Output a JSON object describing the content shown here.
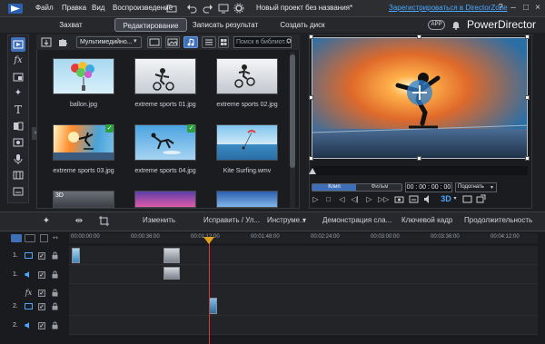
{
  "menu": {
    "file": "Файл",
    "edit": "Правка",
    "view": "Вид",
    "play": "Воспроизведение",
    "doc_title": "Новый проект без названия*",
    "register": "Зарегистрироваться в DirectorZone"
  },
  "modes": {
    "capture": "Захват",
    "edit": "Редактирование",
    "produce": "Записать результат",
    "disc": "Создать диск"
  },
  "app_badge": "APP",
  "brand": "PowerDirector",
  "library": {
    "media_select": "Мультимедийно...",
    "search_placeholder": "Поиск в библиот...",
    "items": [
      {
        "name": "ballon.jpg"
      },
      {
        "name": "extreme sports 01.jpg"
      },
      {
        "name": "extreme sports 02.jpg"
      },
      {
        "name": "extreme sports 03.jpg"
      },
      {
        "name": "extreme sports 04.jpg"
      },
      {
        "name": "Kite Surfing.wmv"
      }
    ],
    "row3_badge": "3D"
  },
  "preview": {
    "tab_clip": "Клип",
    "tab_movie": "Фильм",
    "timecode": "00 : 00 : 00 : 00",
    "fit": "Подогнать",
    "threed": "3D"
  },
  "edit_bar": {
    "modify": "Изменить",
    "fix": "Исправить / Ул...",
    "tools": "Инструме...",
    "slideshow": "Демонстрация сла...",
    "keyframe": "Ключевой кадр",
    "duration": "Продолжительность"
  },
  "ruler": [
    "00:00:00:00",
    "00:00:36:00",
    "00:01:12:00",
    "00:01:48:00",
    "00:02:24:00",
    "00:03:00:00",
    "00:03:36:00",
    "00:04:12:00"
  ],
  "tracks": [
    {
      "label": "1."
    },
    {
      "label": "1."
    },
    {
      "label": ""
    },
    {
      "label": "2."
    },
    {
      "label": "2."
    }
  ]
}
